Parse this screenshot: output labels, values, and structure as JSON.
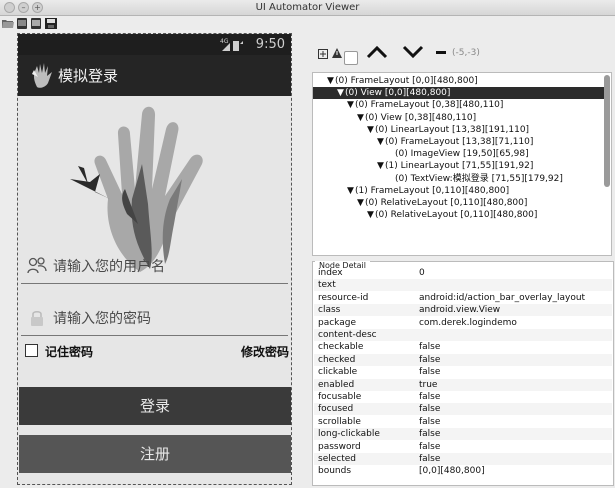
{
  "window": {
    "title": "UI Automator Viewer"
  },
  "device": {
    "status_time": "9:50",
    "app_title": "模拟登录",
    "username_hint": "请输入您的用户名",
    "password_hint": "请输入您的密码",
    "remember_label": "记住密码",
    "modify_label": "修改密码",
    "login_button": "登录",
    "register_button": "注册"
  },
  "controls": {
    "coords": "(-5,-3)"
  },
  "tree": [
    {
      "text": "(0) FrameLayout [0,0][480,800]",
      "indent": 0,
      "arrow": "▼",
      "selected": false
    },
    {
      "text": "(0) View [0,0][480,800]",
      "indent": 1,
      "arrow": "▼",
      "selected": true
    },
    {
      "text": "(0) FrameLayout [0,38][480,110]",
      "indent": 2,
      "arrow": "▼",
      "selected": false
    },
    {
      "text": "(0) View [0,38][480,110]",
      "indent": 3,
      "arrow": "▼",
      "selected": false
    },
    {
      "text": "(0) LinearLayout [13,38][191,110]",
      "indent": 4,
      "arrow": "▼",
      "selected": false
    },
    {
      "text": "(0) FrameLayout [13,38][71,110]",
      "indent": 5,
      "arrow": "▼",
      "selected": false
    },
    {
      "text": "(0) ImageView [19,50][65,98]",
      "indent": 6,
      "arrow": "",
      "selected": false
    },
    {
      "text": "(1) LinearLayout [71,55][191,92]",
      "indent": 5,
      "arrow": "▼",
      "selected": false
    },
    {
      "text": "(0) TextView:模拟登录 [71,55][179,92]",
      "indent": 6,
      "arrow": "",
      "selected": false
    },
    {
      "text": "(1) FrameLayout [0,110][480,800]",
      "indent": 2,
      "arrow": "▼",
      "selected": false
    },
    {
      "text": "(0) RelativeLayout [0,110][480,800]",
      "indent": 3,
      "arrow": "▼",
      "selected": false
    },
    {
      "text": "(0) RelativeLayout [0,110][480,800]",
      "indent": 4,
      "arrow": "▼",
      "selected": false
    }
  ],
  "detail": {
    "title": "Node Detail",
    "rows": [
      {
        "k": "index",
        "v": "0"
      },
      {
        "k": "text",
        "v": ""
      },
      {
        "k": "resource-id",
        "v": "android:id/action_bar_overlay_layout"
      },
      {
        "k": "class",
        "v": "android.view.View"
      },
      {
        "k": "package",
        "v": "com.derek.logindemo"
      },
      {
        "k": "content-desc",
        "v": ""
      },
      {
        "k": "checkable",
        "v": "false"
      },
      {
        "k": "checked",
        "v": "false"
      },
      {
        "k": "clickable",
        "v": "false"
      },
      {
        "k": "enabled",
        "v": "true"
      },
      {
        "k": "focusable",
        "v": "false"
      },
      {
        "k": "focused",
        "v": "false"
      },
      {
        "k": "scrollable",
        "v": "false"
      },
      {
        "k": "long-clickable",
        "v": "false"
      },
      {
        "k": "password",
        "v": "false"
      },
      {
        "k": "selected",
        "v": "false"
      },
      {
        "k": "bounds",
        "v": "[0,0][480,800]"
      }
    ]
  }
}
